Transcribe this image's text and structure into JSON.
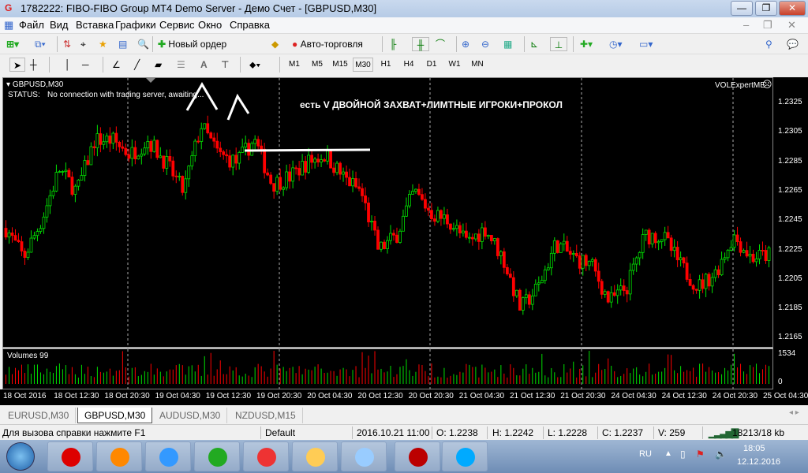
{
  "window": {
    "title": "1782222: FIBO-FIBO Group MT4 Demo Server - Демо Счет - [GBPUSD,M30]"
  },
  "menu": [
    "Файл",
    "Вид",
    "Вставка",
    "Графики",
    "Сервис",
    "Окно",
    "Справка"
  ],
  "toolbar": {
    "new_order": "Новый ордер",
    "auto_trading": "Авто-торговля"
  },
  "timeframes": [
    "M1",
    "M5",
    "M15",
    "M30",
    "H1",
    "H4",
    "D1",
    "W1",
    "MN"
  ],
  "active_timeframe": "M30",
  "chart": {
    "symbol": "GBPUSD,M30",
    "status_label": "STATUS:",
    "status_text": "No connection with trading server, awaiting...",
    "annotation": "есть V ДВОЙНОЙ ЗАХВАТ+ЛИМТНЫЕ ИГРОКИ+ПРОКОЛ",
    "expert": "VOLExpertME",
    "price_ticks": [
      "1.2325",
      "1.2305",
      "1.2285",
      "1.2265",
      "1.2245",
      "1.2225",
      "1.2205",
      "1.2185",
      "1.2165"
    ],
    "volumes_label": "Volumes 99",
    "volume_ticks": [
      "1534",
      "0"
    ],
    "date_ticks": [
      "18 Oct 2016",
      "18 Oct 12:30",
      "18 Oct 20:30",
      "19 Oct 04:30",
      "19 Oct 12:30",
      "19 Oct 20:30",
      "20 Oct 04:30",
      "20 Oct 12:30",
      "20 Oct 20:30",
      "21 Oct 04:30",
      "21 Oct 12:30",
      "21 Oct 20:30",
      "24 Oct 04:30",
      "24 Oct 12:30",
      "24 Oct 20:30",
      "25 Oct 04:30"
    ],
    "price_path": [
      1.224,
      1.222,
      1.2245,
      1.228,
      1.2265,
      1.23,
      1.23,
      1.229,
      1.23,
      1.2285,
      1.2265,
      1.231,
      1.229,
      1.2285,
      1.23,
      1.227,
      1.2275,
      1.2285,
      1.229,
      1.2275,
      1.2265,
      1.2225,
      1.2235,
      1.2265,
      1.225,
      1.2245,
      1.223,
      1.224,
      1.222,
      1.2185,
      1.22,
      1.223,
      1.222,
      1.2215,
      1.219,
      1.22,
      1.2235,
      1.2235,
      1.2215,
      1.22,
      1.221,
      1.2235,
      1.222,
      1.2222
    ],
    "bull_color": "#00e000",
    "bear_color": "#ff0000"
  },
  "tabs": [
    {
      "label": "EURUSD,M30"
    },
    {
      "label": "GBPUSD,M30",
      "active": true
    },
    {
      "label": "AUDUSD,M30"
    },
    {
      "label": "NZDUSD,M15"
    }
  ],
  "status": {
    "help": "Для вызова справки нажмите F1",
    "profile": "Default",
    "datetime": "2016.10.21 11:00",
    "open": "O: 1.2238",
    "high": "H: 1.2242",
    "low": "L: 1.2228",
    "close": "C: 1.2237",
    "volume": "V: 259",
    "traffic": "18213/18 kb"
  },
  "taskbar": {
    "lang": "RU",
    "time": "18:05",
    "date": "12.12.2016",
    "apps": [
      "opera",
      "media-player",
      "internet-explorer",
      "chrome",
      "fibo-mt4",
      "explorer",
      "paint",
      "acrobat",
      "skype"
    ]
  }
}
